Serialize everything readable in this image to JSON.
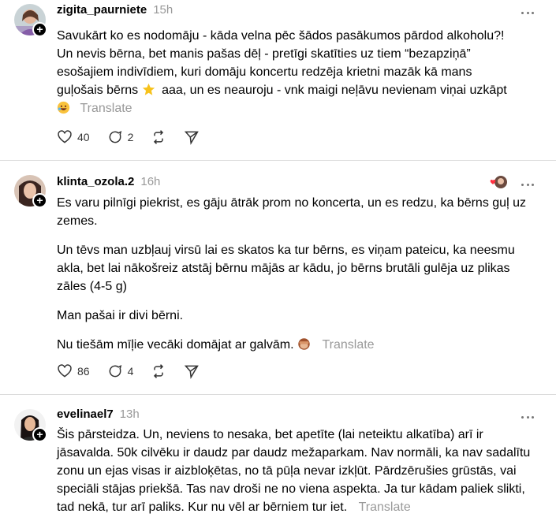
{
  "posts": [
    {
      "username": "zigita_paurniete",
      "time": "15h",
      "text_lines": [
        "Savukārt ko es nodomāju - kāda velna pēc šādos pasākumos pārdod alkoholu?!",
        "Un nevis bērna, bet manis pašas dēļ - pretīgi skatīties uz tiem “bezapziņā”",
        "esošajiem indivīdiem, kuri domāju koncertu redzēja krietni mazāk kā mans",
        "guļošais bērns",
        "aaa, un es neauroju - vnk maigi neļāvu nevienam viņai uzkāpt"
      ],
      "translate": "Translate",
      "likes": "40",
      "replies": "2"
    },
    {
      "username": "klinta_ozola.2",
      "time": "16h",
      "paragraphs": [
        "Es varu pilnīgi piekrist, es gāju ātrāk prom no koncerta, un es redzu, ka bērns guļ uz zemes.",
        "Un tēvs man uzbļauj virsū lai es skatos ka tur bērns, es viņam pateicu, ka neesmu akla, bet lai nākošreiz atstāj bērnu mājās ar kādu, jo bērns brutāli gulēja uz plikas zāles (4-5 g)",
        "Man pašai ir divi bērni.",
        "Nu tiešām mīļie vecāki domājat ar galvām."
      ],
      "translate": "Translate",
      "likes": "86",
      "replies": "4"
    },
    {
      "username": "evelinael7",
      "time": "13h",
      "text": "Šis pārsteidza. Un, neviens to nesaka, bet apetīte (lai neteiktu alkatība) arī ir jāsavalda. 50k cilvēku ir daudz par daudz mežaparkam. Nav normāli, ka nav sadalītu zonu un ejas visas ir aizbloķētas, no tā pūļa nevar izkļūt. Pārdzērušies grūstās, vai speciāli stājas priekšā. Tas nav droši ne no viena aspekta. Ja tur kādam paliek slikti, tad nekā, tur arī paliks. Kur nu vēl ar bērniem tur iet.",
      "translate": "Translate"
    }
  ],
  "icons": {
    "like": "heart-icon",
    "reply": "comment-icon",
    "repost": "repost-icon",
    "share": "send-icon",
    "more": "more-dots-icon"
  },
  "colors": {
    "muted": "#999999",
    "divider": "#dcdcdc",
    "like_red": "#ff3040"
  }
}
